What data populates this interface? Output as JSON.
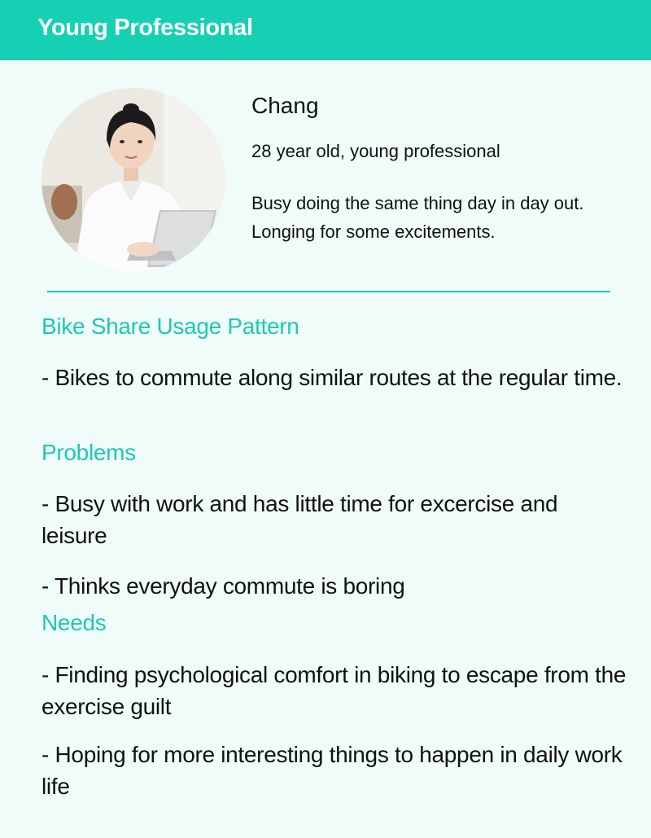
{
  "header": {
    "title": "Young Professional"
  },
  "persona": {
    "name": "Chang",
    "age_line": "28 year old, young professional",
    "bio_lines": [
      "Busy doing the same thing day in day out.",
      "Longing for some excitements."
    ],
    "avatar_icon": "persona-photo-woman-at-laptop"
  },
  "sections": {
    "usage": {
      "heading": "Bike Share Usage Pattern",
      "items": [
        "- Bikes to commute along similar routes at the regular time."
      ]
    },
    "problems": {
      "heading": "Problems",
      "items": [
        "- Busy with work and has little time for excercise and leisure",
        "- Thinks everyday commute is boring"
      ]
    },
    "needs": {
      "heading": "Needs",
      "items": [
        "- Finding psychological comfort in biking to escape from the exercise guilt",
        "- Hoping for more interesting things to happen in daily work life"
      ]
    }
  },
  "colors": {
    "accent": "#16d0b4",
    "heading": "#1dc9b3",
    "background": "#effcfa"
  }
}
